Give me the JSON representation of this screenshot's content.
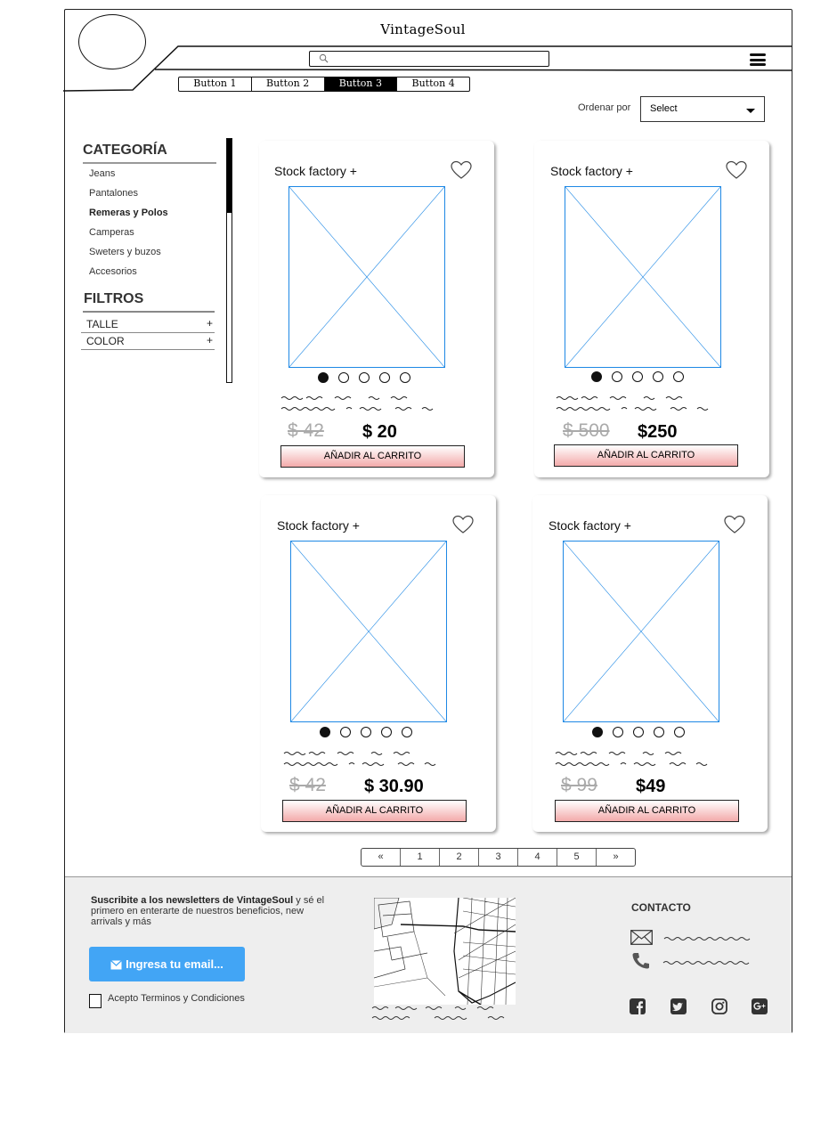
{
  "header": {
    "site_title": "VintageSoul",
    "search": {
      "placeholder": ""
    },
    "nav_buttons": [
      {
        "label": "Button 1",
        "active": false
      },
      {
        "label": "Button 2",
        "active": false
      },
      {
        "label": "Button 3",
        "active": true
      },
      {
        "label": "Button 4",
        "active": false
      }
    ]
  },
  "sort": {
    "label": "Ordenar por",
    "selected": "Select"
  },
  "sidebar": {
    "category_title": "CATEGORÍA",
    "categories": [
      {
        "label": "Jeans",
        "selected": false
      },
      {
        "label": "Pantalones",
        "selected": false
      },
      {
        "label": "Remeras y Polos",
        "selected": true
      },
      {
        "label": "Camperas",
        "selected": false
      },
      {
        "label": "Sweters y buzos",
        "selected": false
      },
      {
        "label": "Accesorios",
        "selected": false
      }
    ],
    "filters_title": "FILTROS",
    "filters": [
      {
        "label": "TALLE",
        "toggle": "+"
      },
      {
        "label": "COLOR",
        "toggle": "+"
      }
    ]
  },
  "products": [
    {
      "brand": "Stock factory +",
      "old_price": "$ 42",
      "new_price": "$ 20",
      "cart_label": "AÑADIR AL CARRITO",
      "active_dot": 0,
      "dot_count": 5
    },
    {
      "brand": "Stock factory +",
      "old_price": "$ 500",
      "new_price": "$250",
      "cart_label": "AÑADIR AL CARRITO",
      "active_dot": 0,
      "dot_count": 5
    },
    {
      "brand": "Stock factory +",
      "old_price": "$ 42",
      "new_price": "$ 30.90",
      "cart_label": "AÑADIR AL CARRITO",
      "active_dot": 0,
      "dot_count": 5
    },
    {
      "brand": "Stock factory +",
      "old_price": "$ 99",
      "new_price": "$49",
      "cart_label": "AÑADIR AL CARRITO",
      "active_dot": 0,
      "dot_count": 5
    }
  ],
  "pagination": {
    "first": "«",
    "pages": [
      "1",
      "2",
      "3",
      "4",
      "5"
    ],
    "last": "»"
  },
  "footer": {
    "newsletter_bold": "Suscribite a los newsletters de VintageSoul",
    "newsletter_rest": " y sé el primero en enterarte de nuestros beneficios, new arrivals y más",
    "email_button": "Ingresa tu email...",
    "terms_label": "Acepto Terminos y Condiciones",
    "contact_title": "CONTACTO",
    "social_icons": [
      "facebook-icon",
      "twitter-icon",
      "instagram-icon",
      "google-plus-icon"
    ]
  },
  "colors": {
    "accent_blue": "#42a5f5",
    "cart_gradient_end": "#f3aaaa",
    "image_placeholder": "#1e88e5"
  }
}
